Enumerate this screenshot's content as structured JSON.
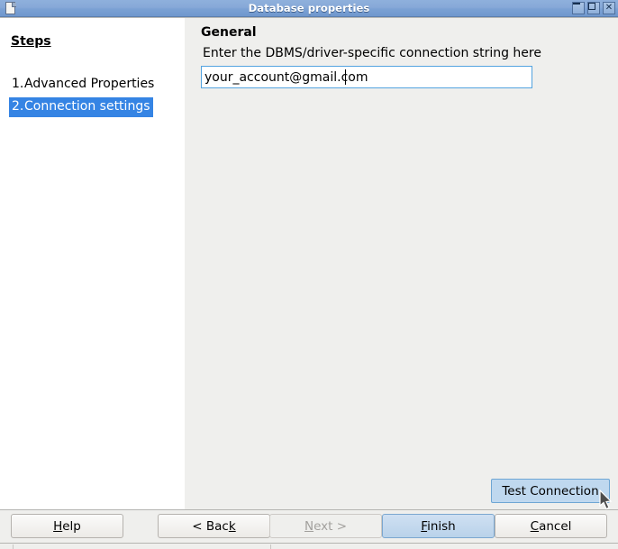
{
  "window": {
    "title": "Database properties",
    "icon": "document-icon",
    "controls": [
      {
        "name": "minimize",
        "glyph": "_"
      },
      {
        "name": "maximize",
        "glyph": "□"
      },
      {
        "name": "close",
        "glyph": "✕"
      }
    ]
  },
  "sidebar": {
    "heading": "Steps",
    "items": [
      {
        "number": "1.",
        "label": "Advanced Properties",
        "selected": false
      },
      {
        "number": "2.",
        "label": "Connection settings",
        "selected": true
      }
    ]
  },
  "main": {
    "section_title": "General",
    "field_label": "Enter the DBMS/driver-specific connection string here",
    "connection_string": {
      "value": "your_account@gmail.com",
      "placeholder": ""
    },
    "test_connection_label": "Test Connection"
  },
  "buttons": {
    "help": {
      "label": "Help",
      "mnemonic": "H",
      "disabled": false
    },
    "back": {
      "label": "< Back",
      "mnemonic": "k",
      "disabled": false
    },
    "next": {
      "label": "Next >",
      "mnemonic": "N",
      "disabled": true
    },
    "finish": {
      "label": "Finish",
      "mnemonic": "F",
      "disabled": false,
      "default": true
    },
    "cancel": {
      "label": "Cancel",
      "mnemonic": "C",
      "disabled": false
    }
  },
  "colors": {
    "titlebar_blue": "#7ba1d4",
    "selection_blue": "#3584e4",
    "focus_border": "#53a3e0",
    "default_button_blue": "#c3d9ee",
    "hover_button_blue": "#bfd8ef",
    "dialog_grey": "#efefed"
  }
}
